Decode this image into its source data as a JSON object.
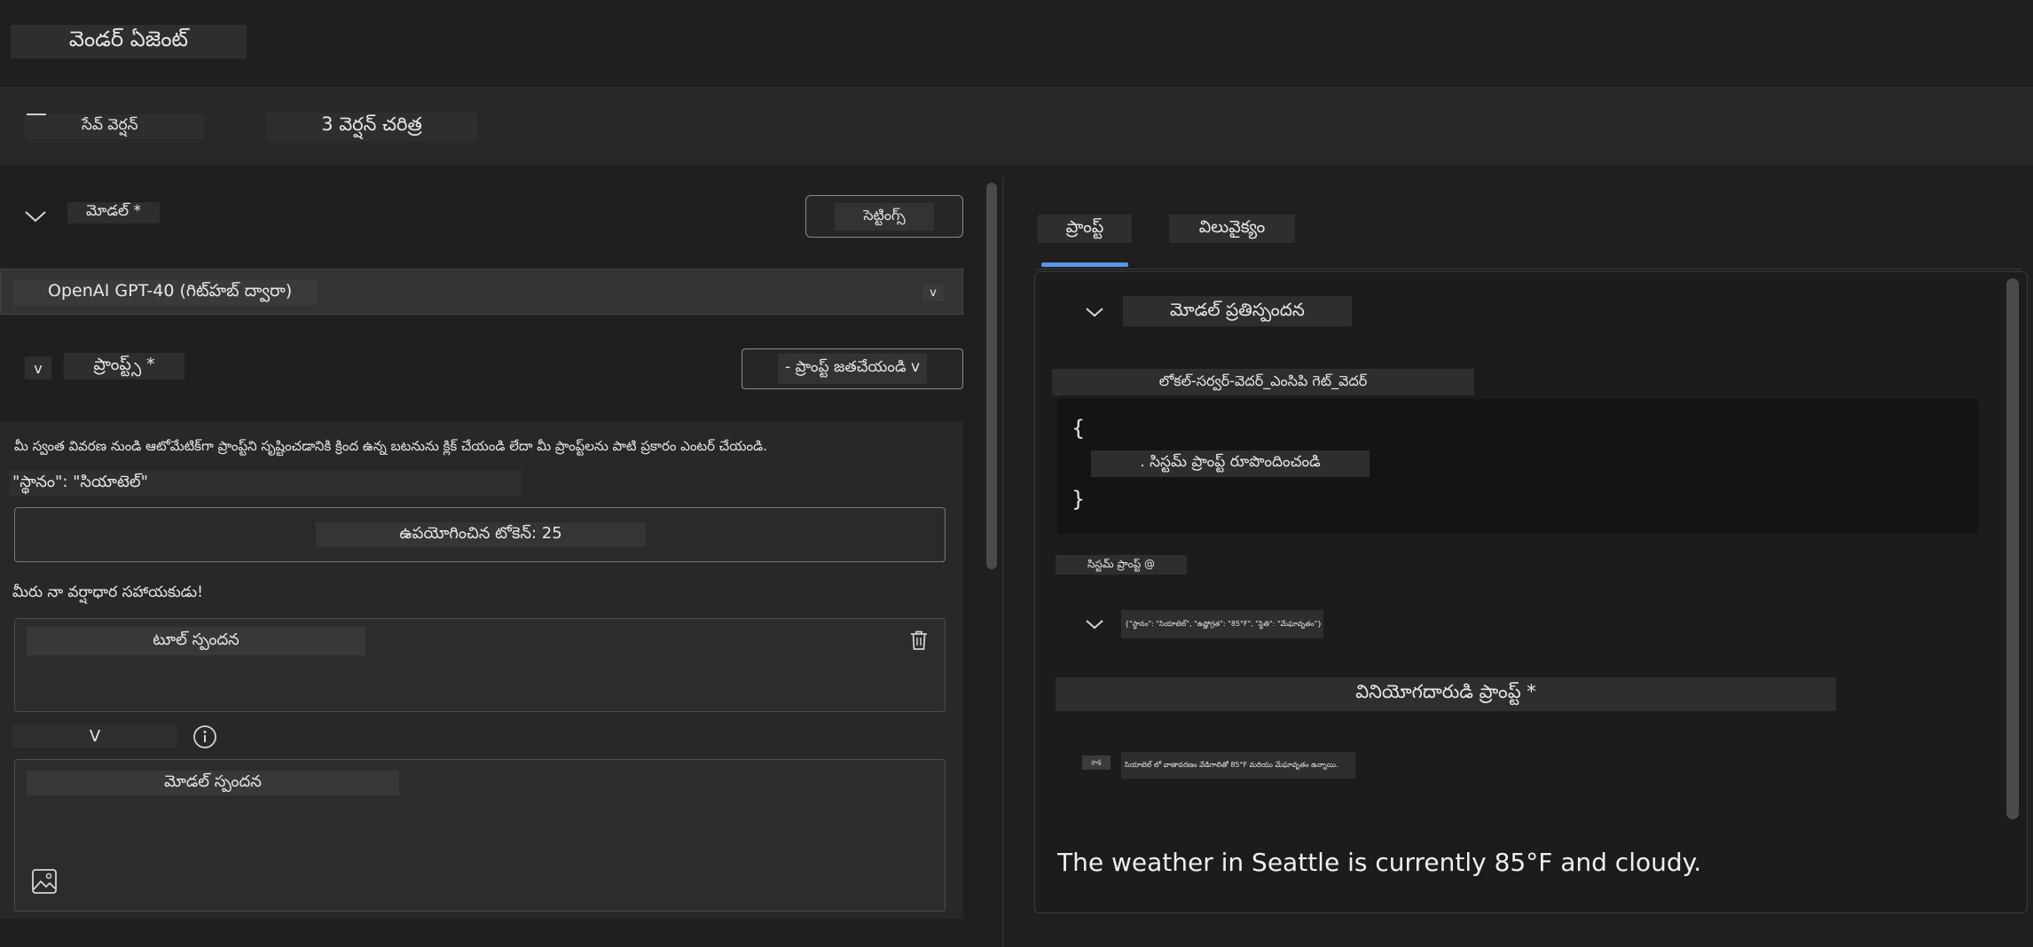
{
  "header": {
    "title": "వెండర్ ఏజెంట్"
  },
  "toolbar": {
    "save_version_label": "సేవ్ వెర్షన్",
    "version_history_label": "3 వెర్షన్ చరిత్ర"
  },
  "left": {
    "model_section_label": "మోడల్ *",
    "settings_button_label": "సెట్టింగ్స్",
    "model_select_value": "OpenAI GPT-40 (గిట్‌హబ్ ద్వారా)",
    "model_select_caret": "v",
    "prompts_chevron": "v",
    "prompts_label": "ప్రాంప్ట్స్ *",
    "generate_prompt_label": "- ప్రాంప్ట్ జతచేయండి v",
    "hint_text": "మీ స్వంత వివరణ నుండి ఆటోమేటిక్‌గా ప్రాంప్ట్‌ని సృష్టించడానికి క్రింద ఉన్న బటనును క్లిక్ చేయండి లేదా మీ ప్రాంప్ట్‌లను పాటి ప్రకారం ఎంటర్ చేయండి.",
    "location_text": "\"స్థానం\": \"సియాటెల్\"",
    "tokens_label": "ఉపయోగించిన టోకెన్: 25",
    "assistant_text": "మీరు నా వర్షాధార సహాయకుడు!",
    "tool_response_label": "టూల్ స్పందన",
    "row_chevron": "V",
    "model_response_label": "మోడల్ స్పందన"
  },
  "right": {
    "tabs": [
      {
        "label": "ప్రాంప్ట్"
      },
      {
        "label": "విలువైక్యం"
      }
    ],
    "response_title": "మోడల్ ప్రతిస్పందన",
    "server_label": "లోకల్-సర్వర్-వెదర్_ఎంసిపి గెట్_వెదర్",
    "code_open": "{",
    "code_line": ". సిస్టమ్ ప్రాంప్ట్ రూపొందించండి",
    "code_close": "}",
    "system_prompt_label": "సిస్టమ్ ప్రాంప్ట్ @",
    "json_text": "{\"స్థానం\": \"సియాటెల్\", \"ఉష్ణోగ్రత\": \"85°F\", \"స్థితి\": \"మేఘావృతం\"}",
    "user_prompt_label": "వినియోగదారుడి ప్రాంప్ట్ *",
    "user_prompt_tag": "ప్రాంప్ట్",
    "user_prompt_text": "సియాటెల్ లో వాతావరణం వేడిగాలితో 85°F మరియు మేఘావృతం ఉన్నాయి.",
    "weather_text": "The weather in Seattle is currently 85°F and cloudy."
  },
  "colors": {
    "background": "#1f1f1f",
    "panel": "#282828",
    "accent": "#5a96e6",
    "text": "#e6e6e6"
  },
  "icons": [
    "chevron-down-icon",
    "trash-icon",
    "info-icon",
    "image-icon"
  ]
}
